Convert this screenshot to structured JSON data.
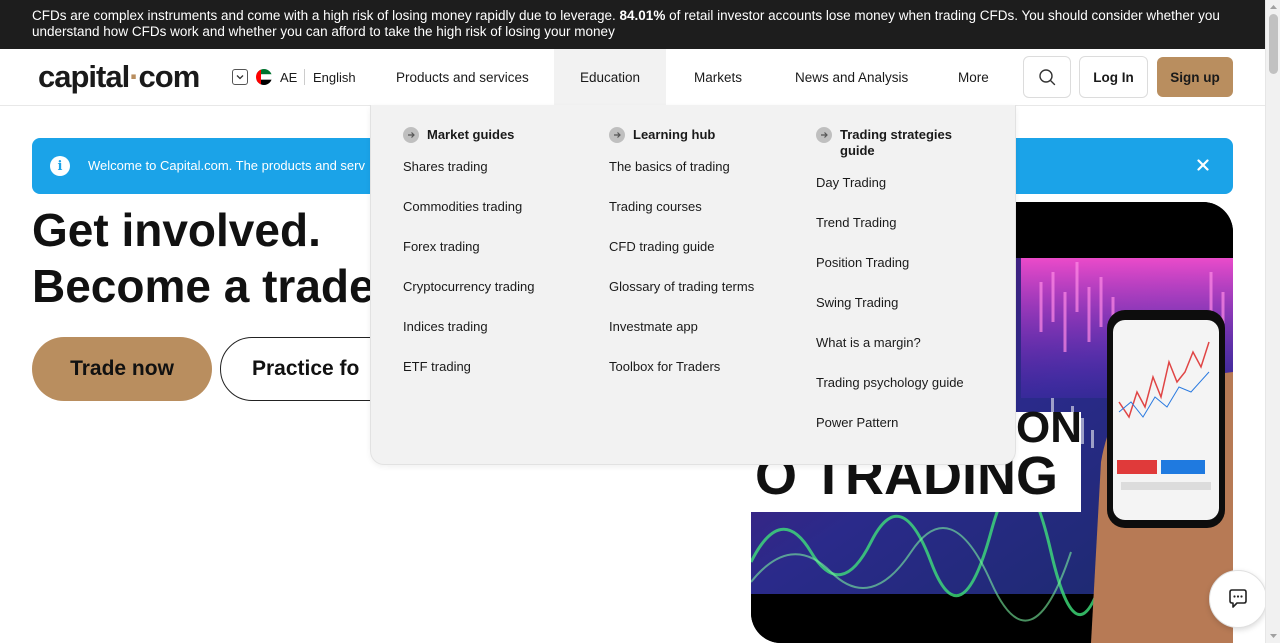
{
  "risk_warning": {
    "part1": "CFDs are complex instruments and come with a high risk of losing money rapidly due to leverage. ",
    "percent": "84.01%",
    "part2": " of retail investor accounts lose money when trading CFDs. You should consider whether you understand how CFDs work and whether you can afford to take the high risk of losing your money"
  },
  "header": {
    "logo_main": "capital",
    "logo_dot": "·",
    "logo_suffix": "com",
    "region": "AE",
    "language": "English",
    "nav": [
      {
        "label": "Products and services"
      },
      {
        "label": "Education"
      },
      {
        "label": "Markets"
      },
      {
        "label": "News and Analysis"
      },
      {
        "label": "More"
      }
    ],
    "login": "Log In",
    "signup": "Sign up"
  },
  "info_bar": {
    "text": "Welcome to Capital.com. The products and serv"
  },
  "hero": {
    "line1": "Get involved.",
    "line2": "Become a trade",
    "trade_now": "Trade now",
    "practice": "Practice fo"
  },
  "video": {
    "caption_top": "ON",
    "caption_bottom": "O TRADING"
  },
  "dropdown": {
    "columns": [
      {
        "title": "Market guides",
        "items": [
          "Shares trading",
          "Commodities trading",
          "Forex trading",
          "Cryptocurrency trading",
          "Indices trading",
          "ETF trading"
        ]
      },
      {
        "title": "Learning hub",
        "items": [
          "The basics of trading",
          "Trading courses",
          "CFD trading guide",
          "Glossary of trading terms",
          "Investmate app",
          "Toolbox for Traders"
        ]
      },
      {
        "title": "Trading strategies guide",
        "items": [
          "Day Trading",
          "Trend Trading",
          "Position Trading",
          "Swing Trading",
          "What is a margin?",
          "Trading psychology guide",
          "Power Pattern"
        ]
      }
    ]
  },
  "colors": {
    "brand": "#b98e5f",
    "info": "#1ba3e8",
    "banner": "#1d1d1d"
  },
  "icons": {
    "search": "search-icon",
    "chat": "chat-icon",
    "info": "info-icon",
    "close": "close-icon"
  }
}
